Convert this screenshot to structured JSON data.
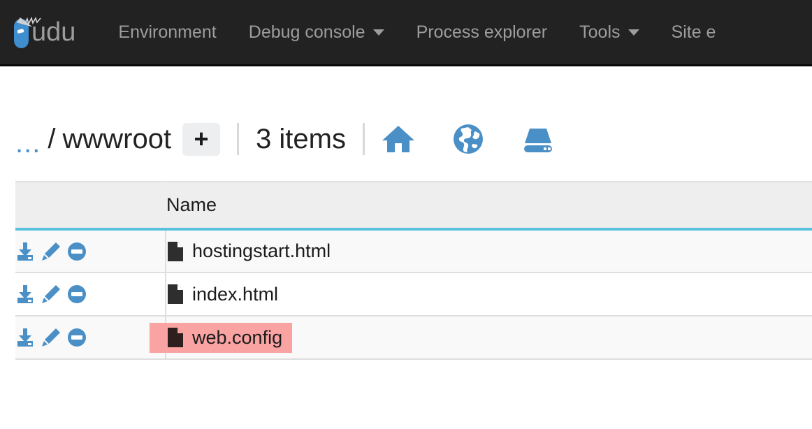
{
  "navbar": {
    "brand": {
      "icon": "kudu-knife-logo",
      "text": "udu",
      "full_text": "Kudu"
    },
    "items": [
      {
        "label": "Environment",
        "has_caret": false,
        "icon": ""
      },
      {
        "label": "Debug console",
        "has_caret": true,
        "icon": "chevron-down-icon"
      },
      {
        "label": "Process explorer",
        "has_caret": false,
        "icon": ""
      },
      {
        "label": "Tools",
        "has_caret": true,
        "icon": "chevron-down-icon"
      },
      {
        "label": "Site e",
        "has_caret": false,
        "icon": ""
      }
    ],
    "background_color": "#222222",
    "text_color": "#9d9d9d"
  },
  "breadcrumb": {
    "ellipsis": "...",
    "separator": "/",
    "current": "wwwroot",
    "add_label": "+",
    "item_count": "3 items",
    "icons": [
      {
        "name": "home-icon",
        "color": "#4a90c7"
      },
      {
        "name": "globe-icon",
        "color": "#4a90c7"
      },
      {
        "name": "hard-drive-icon",
        "color": "#4a90c7"
      }
    ]
  },
  "table": {
    "columns": [
      {
        "key": "actions",
        "label": ""
      },
      {
        "key": "name",
        "label": "Name"
      }
    ],
    "header_border_color": "#5BC0DE",
    "highlight_color": "#F9A3A3",
    "row_actions": [
      {
        "name": "download-icon",
        "title": "download"
      },
      {
        "name": "edit-pencil-icon",
        "title": "edit"
      },
      {
        "name": "delete-minus-circle-icon",
        "title": "delete"
      }
    ],
    "rows": [
      {
        "name": "hostingstart.html",
        "icon": "file-icon",
        "highlighted": false
      },
      {
        "name": "index.html",
        "icon": "file-icon",
        "highlighted": false
      },
      {
        "name": "web.config",
        "icon": "file-icon",
        "highlighted": true
      }
    ]
  }
}
